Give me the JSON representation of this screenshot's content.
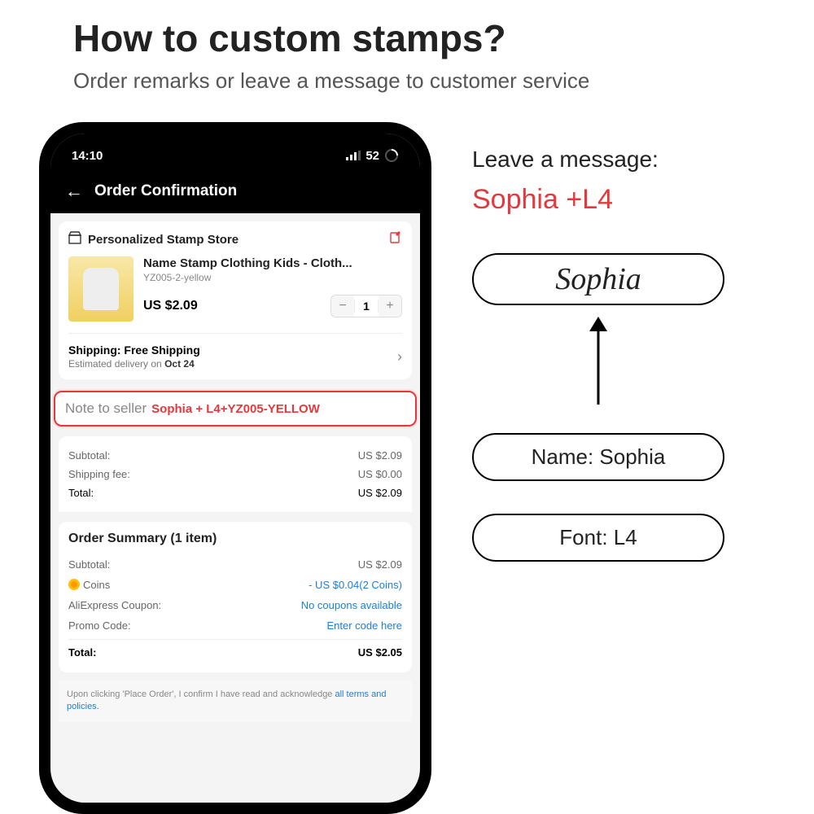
{
  "page": {
    "title": "How to custom stamps?",
    "subtitle": "Order remarks or leave a message to customer service"
  },
  "status": {
    "time": "14:10",
    "battery": "52"
  },
  "header": {
    "title": "Order Confirmation"
  },
  "store": {
    "name": "Personalized Stamp Store"
  },
  "product": {
    "title": "Name Stamp Clothing Kids - Cloth...",
    "sku": "YZ005-2-yellow",
    "price": "US $2.09",
    "qty": "1"
  },
  "shipping": {
    "label": "Shipping: Free Shipping",
    "eta_prefix": "Estimated delivery on ",
    "eta_date": "Oct 24"
  },
  "note": {
    "label": "Note to seller",
    "value": "Sophia + L4+YZ005-YELLOW"
  },
  "totals1": {
    "subtotal_label": "Subtotal:",
    "subtotal": "US $2.09",
    "shipfee_label": "Shipping fee:",
    "shipfee": "US $0.00",
    "total_label": "Total:",
    "total": "US $2.09"
  },
  "summary": {
    "heading": "Order Summary (1 item)",
    "subtotal_label": "Subtotal:",
    "subtotal": "US $2.09",
    "coins_label": "Coins",
    "coins_value": "- US $0.04(2 Coins)",
    "coupon_label": "AliExpress Coupon:",
    "coupon_value": "No coupons available",
    "promo_label": "Promo Code:",
    "promo_value": "Enter code here",
    "total_label": "Total:",
    "total": "US $2.05"
  },
  "ack": {
    "text": "Upon clicking 'Place Order', I confirm I have read and acknowledge ",
    "link": "all terms and policies."
  },
  "right": {
    "msg_label": "Leave a message:",
    "msg_value": "Sophia +L4",
    "signature": "Sophia",
    "name_pill": "Name: Sophia",
    "font_pill": "Font: L4"
  }
}
